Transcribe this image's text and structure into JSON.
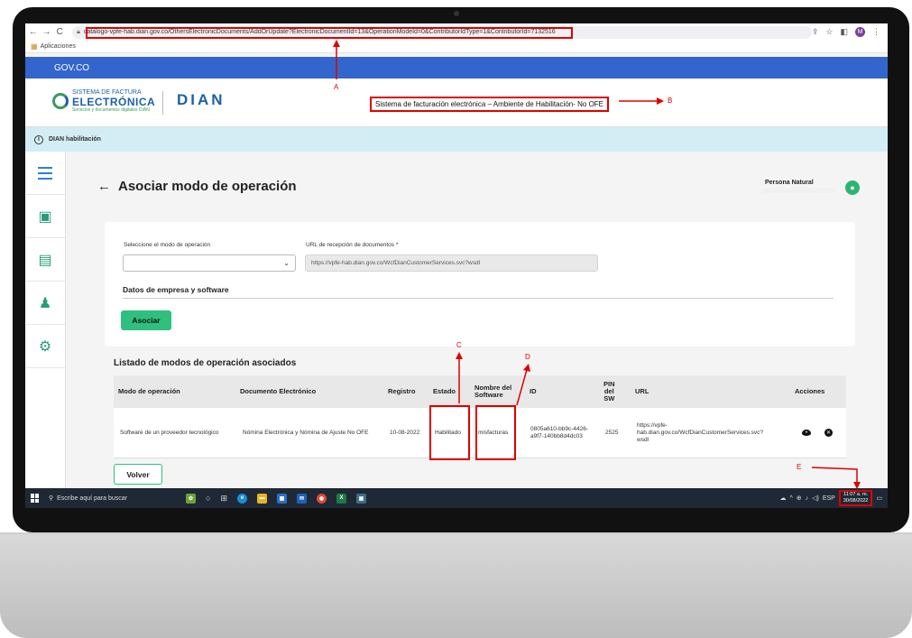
{
  "browser": {
    "url": "catalogo-vpfe-hab.dian.gov.co/OthersElectronicDocuments/AddOrUpdate?ElectronicDocumentId=13&OperationModeId=0&ContributorIdType=1&ContributorId=7132516",
    "bookmarks_label": "Aplicaciones",
    "profile_initial": "M"
  },
  "gov": {
    "label": "GOV.CO"
  },
  "header": {
    "logo_line1": "SISTEMA DE FACTURA",
    "logo_line2": "ELECTRÓNICA",
    "logo_line3": "Servicios y documentos digitales DIAN",
    "dian_logo": "DIAN",
    "env_title": "Sistema de facturación electrónica – Ambiente de Habilitación- No OFE"
  },
  "info": {
    "text": "DIAN habilitación",
    "icon": "i"
  },
  "page": {
    "title": "Asociar modo de operación",
    "user_name": "Persona Natural"
  },
  "form": {
    "mode_label": "Seleccione el modo de operación",
    "mode_value": "",
    "url_label": "URL de recepción de documentos *",
    "url_value": "https://vpfe-hab.dian.gov.co/WcfDianCustomerServices.svc?wsdl",
    "section_title": "Datos de empresa y software",
    "submit_label": "Asociar"
  },
  "list": {
    "title": "Listado de modos de operación asociados",
    "headers": {
      "modo": "Modo de operación",
      "documento": "Documento Electrónico",
      "registro": "Registro",
      "estado": "Estado",
      "nombre_sw_1": "Nombre del",
      "nombre_sw_2": "Software",
      "id": "ID",
      "pin_1": "PIN",
      "pin_2": "del",
      "pin_3": "SW",
      "url": "URL",
      "acciones": "Acciones"
    },
    "rows": [
      {
        "modo": "Software de un proveedor tecnológico",
        "documento": "Nómina Electrónica y Nómina de Ajuste No OFE",
        "registro": "10-08-2022",
        "estado": "Habilitado",
        "nombre_sw": "misfacturas",
        "id_1": "0805a610-bb9c-4426-",
        "id_2": "a9f7-140bb8d4dc03",
        "pin": "2525",
        "url_1": "https://vpfe-",
        "url_2": "hab.dian.gov.co/WcfDianCustomerServices.svc?",
        "url_3": "wsdl"
      }
    ]
  },
  "back_label": "Volver",
  "taskbar": {
    "search_placeholder": "Escribe aquí para buscar",
    "lang": "ESP",
    "time": "11:07 a. m.",
    "date": "30/08/2022"
  },
  "annotations": {
    "a": "A",
    "b": "B",
    "c": "C",
    "d": "D",
    "e": "E"
  },
  "colors": {
    "gov_blue": "#3366cc",
    "accent_green": "#2fc07e",
    "annotation_red": "#e00000",
    "info_bg": "#d3edf5"
  }
}
